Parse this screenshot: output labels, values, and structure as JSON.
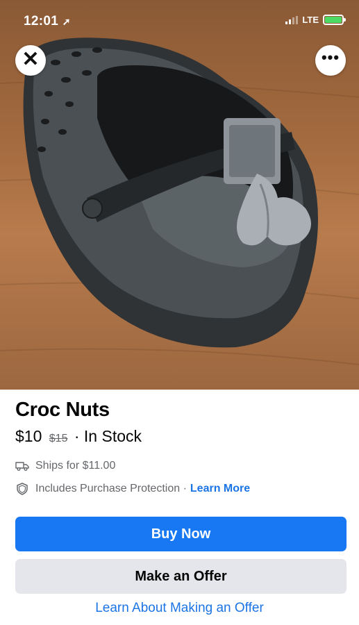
{
  "status_bar": {
    "time": "12:01",
    "carrier": "LTE"
  },
  "top_actions": {
    "close_glyph": "✕",
    "more_glyph": "•••"
  },
  "listing": {
    "title": "Croc Nuts",
    "price": "$10",
    "original_price": "$15",
    "stock_text": "· In Stock",
    "shipping": "Ships for $11.00",
    "protection": "Includes Purchase Protection ·",
    "protection_link": "Learn More"
  },
  "actions": {
    "buy_now": "Buy Now",
    "make_offer": "Make an Offer",
    "offer_info_link": "Learn About Making an Offer"
  },
  "colors": {
    "accent": "#1877f2",
    "link": "#1b74e4",
    "secondary_button": "#e4e6eb"
  },
  "icons": [
    "location-arrow-icon",
    "signal-icon",
    "battery-icon",
    "close-icon",
    "more-icon",
    "truck-icon",
    "shield-icon"
  ]
}
